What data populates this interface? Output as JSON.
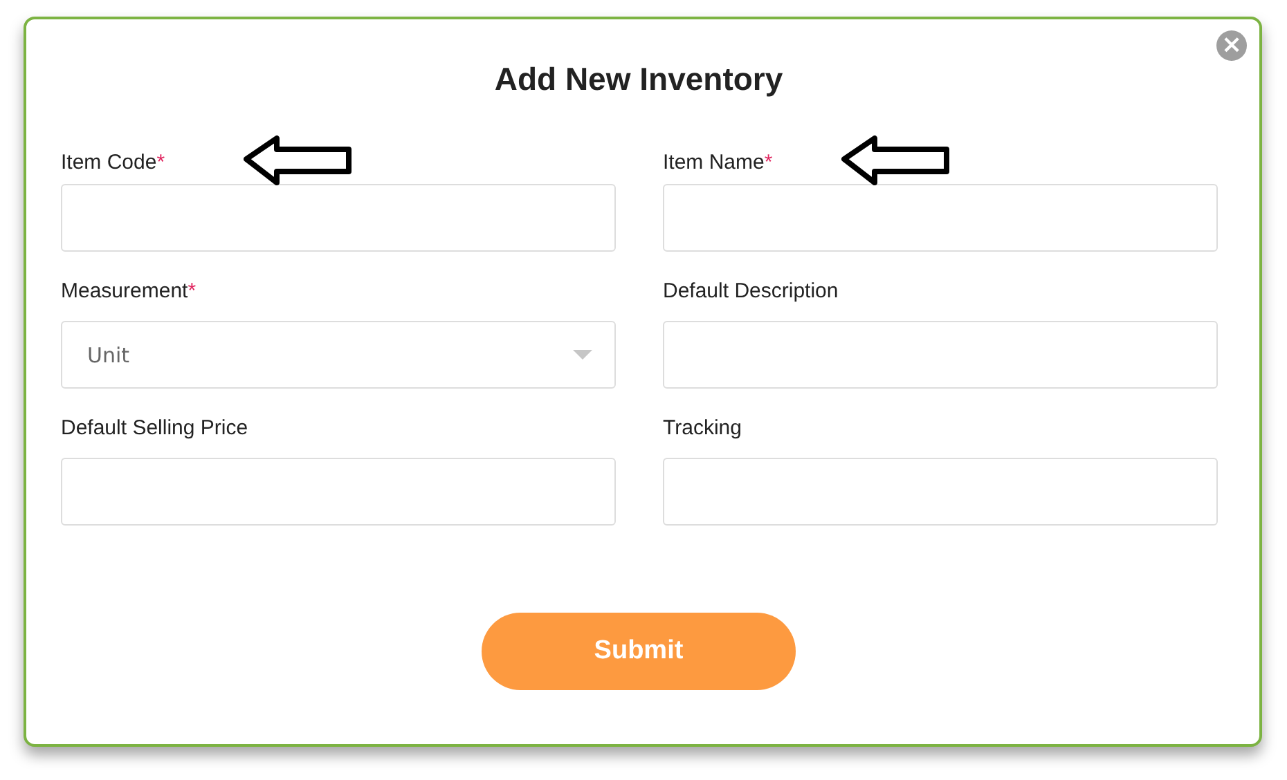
{
  "dialog": {
    "title": "Add New Inventory",
    "close_glyph": "×"
  },
  "fields": [
    {
      "kind": "text",
      "label": "Item Code",
      "mark": "*",
      "pointed": true
    },
    {
      "kind": "text",
      "label": "Item Name",
      "mark": "*",
      "pointed": true
    },
    {
      "kind": "select",
      "label": "Measurement",
      "mark": "*",
      "value": "Unit",
      "pointed": false
    },
    {
      "kind": "text",
      "label": "Default Description",
      "pointed": false
    },
    {
      "kind": "text",
      "label": "Default Selling Price",
      "pointed": false
    },
    {
      "kind": "text",
      "label": "Tracking",
      "pointed": false
    }
  ],
  "submit": {
    "label": "Submit"
  }
}
